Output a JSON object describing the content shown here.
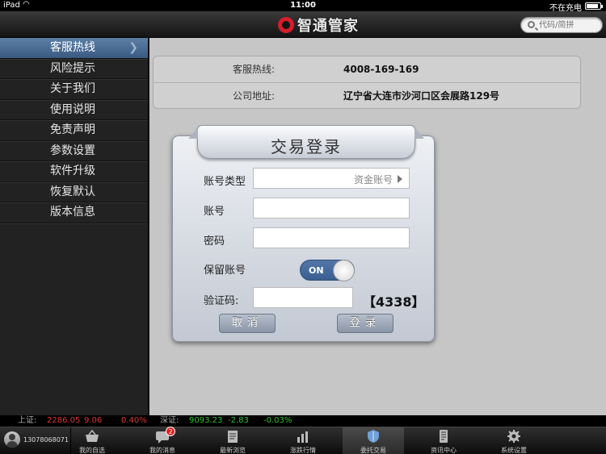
{
  "statusbar": {
    "device": "iPad",
    "time": "11:00",
    "charging": "不在充电",
    "battery_level": 0.85
  },
  "header": {
    "logo_text": "智通管家",
    "search_placeholder": "代码/简拼"
  },
  "sidebar": {
    "items": [
      {
        "label": "客服热线",
        "active": true
      },
      {
        "label": "风险提示"
      },
      {
        "label": "关于我们"
      },
      {
        "label": "使用说明"
      },
      {
        "label": "免责声明"
      },
      {
        "label": "参数设置"
      },
      {
        "label": "软件升级"
      },
      {
        "label": "恢复默认"
      },
      {
        "label": "版本信息"
      }
    ]
  },
  "info": {
    "hotline_label": "客服热线:",
    "hotline_value": "4008-169-169",
    "address_label": "公司地址:",
    "address_value": "辽宁省大连市沙河口区会展路129号"
  },
  "login": {
    "title": "交易登录",
    "account_type_label": "账号类型",
    "account_type_value": "资金账号",
    "account_label": "账号",
    "account_value": "",
    "password_label": "密码",
    "password_value": "",
    "remember_label": "保留账号",
    "remember_state": "ON",
    "captcha_label": "验证码:",
    "captcha_value": "",
    "captcha_code": "【4338】",
    "cancel_label": "取消",
    "login_label": "登录"
  },
  "ticker": {
    "sh_label": "上证:",
    "sh_index": "2286.05",
    "sh_change": "9.06",
    "sh_pct": "0.40%",
    "sz_label": "深证:",
    "sz_index": "9093.23",
    "sz_change": "-2.83",
    "sz_pct": "-0.03%"
  },
  "tabbar": {
    "user_phone": "13078068071",
    "tabs": [
      {
        "label": "我的自选",
        "icon": "basket-icon"
      },
      {
        "label": "我的消息",
        "icon": "message-icon",
        "badge": "2"
      },
      {
        "label": "最新浏览",
        "icon": "history-icon"
      },
      {
        "label": "涨跌行情",
        "icon": "chart-icon"
      },
      {
        "label": "委托交易",
        "icon": "shield-icon",
        "active": true
      },
      {
        "label": "资讯中心",
        "icon": "news-icon"
      },
      {
        "label": "系统设置",
        "icon": "gear-icon"
      }
    ]
  },
  "colors": {
    "accent": "#3b5f91",
    "up": "#e23333",
    "down": "#2fc12f"
  }
}
